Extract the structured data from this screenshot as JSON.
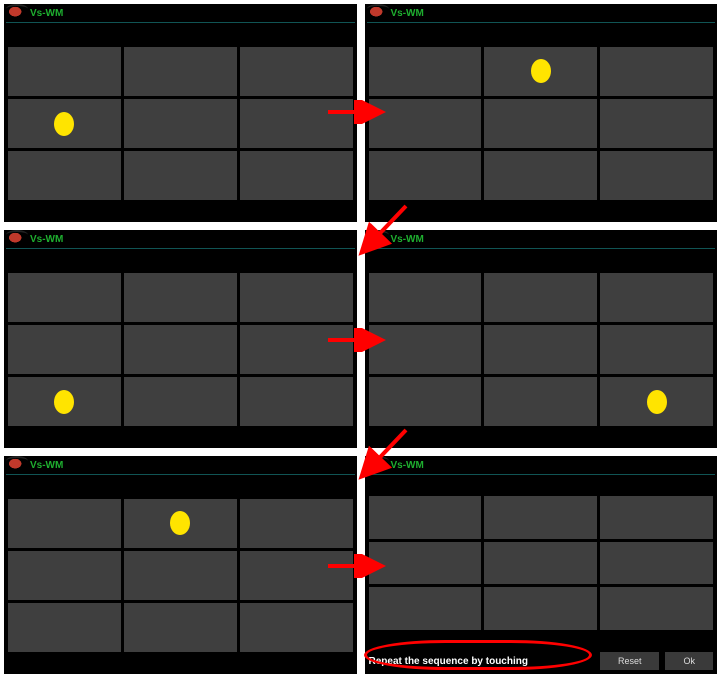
{
  "app_title": "Vs-WM",
  "dot_color": "#ffe400",
  "panels": [
    {
      "id": 0,
      "dot_row": 1,
      "dot_col": 0,
      "show_bottom": false
    },
    {
      "id": 1,
      "dot_row": 0,
      "dot_col": 1,
      "show_bottom": false
    },
    {
      "id": 2,
      "dot_row": 2,
      "dot_col": 0,
      "show_bottom": false
    },
    {
      "id": 3,
      "dot_row": 2,
      "dot_col": 2,
      "show_bottom": false
    },
    {
      "id": 4,
      "dot_row": 0,
      "dot_col": 1,
      "show_bottom": false
    },
    {
      "id": 5,
      "dot_row": null,
      "dot_col": null,
      "show_bottom": true
    }
  ],
  "bottom": {
    "prompt": "Repeat the sequence by touching",
    "reset_label": "Reset",
    "ok_label": "Ok"
  },
  "annotations": {
    "arrows": [
      {
        "from_panel": 0,
        "to_panel": 1,
        "kind": "right"
      },
      {
        "from_panel": 1,
        "to_panel": 2,
        "kind": "diag-down-left"
      },
      {
        "from_panel": 2,
        "to_panel": 3,
        "kind": "right"
      },
      {
        "from_panel": 3,
        "to_panel": 4,
        "kind": "diag-down-left"
      },
      {
        "from_panel": 4,
        "to_panel": 5,
        "kind": "right"
      }
    ],
    "ellipse_on_prompt": true
  }
}
